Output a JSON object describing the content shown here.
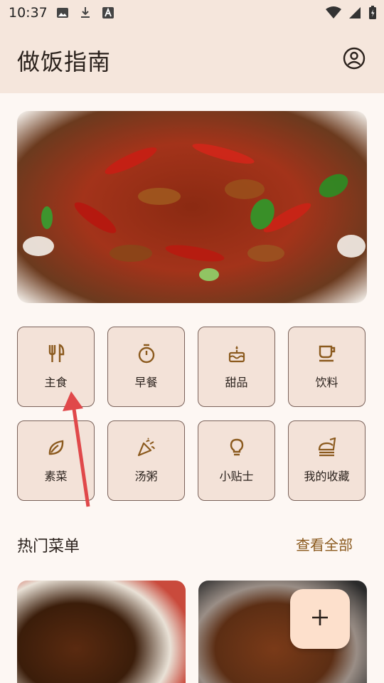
{
  "status": {
    "time": "10:37"
  },
  "appbar": {
    "title": "做饭指南"
  },
  "categories": [
    {
      "label": "主食",
      "icon": "utensils-icon"
    },
    {
      "label": "早餐",
      "icon": "timer-icon"
    },
    {
      "label": "甜品",
      "icon": "cake-icon"
    },
    {
      "label": "饮料",
      "icon": "coffee-cup-icon"
    },
    {
      "label": "素菜",
      "icon": "leaf-icon"
    },
    {
      "label": "汤粥",
      "icon": "party-popper-icon"
    },
    {
      "label": "小贴士",
      "icon": "lightbulb-icon"
    },
    {
      "label": "我的收藏",
      "icon": "dish-icon"
    }
  ],
  "hot": {
    "title": "热门菜单",
    "see_all": "查看全部"
  },
  "colors": {
    "accent": "#8b5a1e",
    "topbar": "#f5e6dc",
    "card": "#f3e2d8",
    "fab": "#fde0cc",
    "annotation": "#e0484a"
  }
}
